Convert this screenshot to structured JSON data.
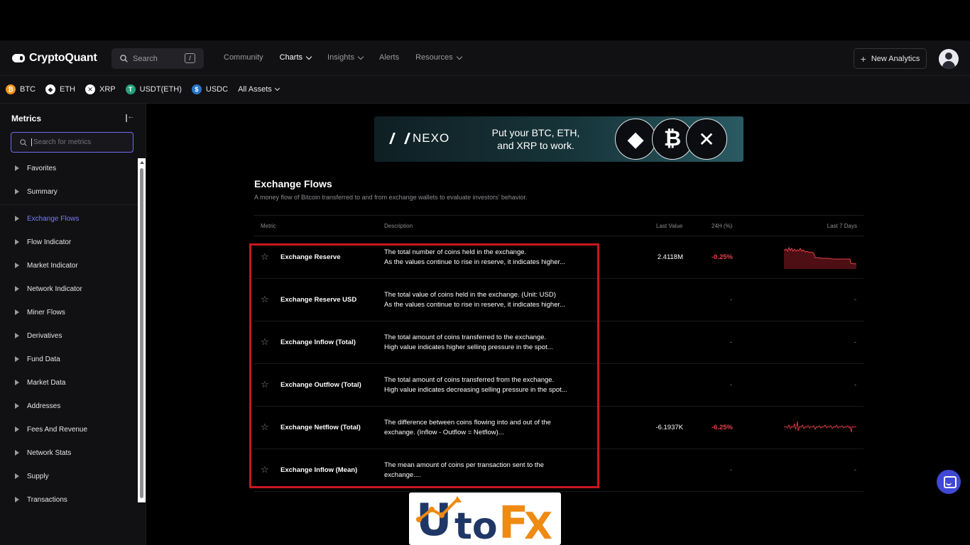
{
  "app": {
    "logo_text": "CryptoQuant",
    "search_placeholder": "Search",
    "search_shortcut": "/",
    "nav": [
      {
        "label": "Community",
        "dropdown": false
      },
      {
        "label": "Charts",
        "dropdown": true,
        "active": true
      },
      {
        "label": "Insights",
        "dropdown": true
      },
      {
        "label": "Alerts",
        "dropdown": false
      },
      {
        "label": "Resources",
        "dropdown": true
      }
    ],
    "new_analytics_label": "New Analytics"
  },
  "assets": [
    {
      "symbol": "BTC",
      "icon": "bitcoin-icon",
      "color": "#f7931a",
      "glyph": "₿"
    },
    {
      "symbol": "ETH",
      "icon": "ethereum-icon",
      "color": "#ffffff",
      "glyph": "◆"
    },
    {
      "symbol": "XRP",
      "icon": "xrp-icon",
      "color": "#ffffff",
      "glyph": "✕"
    },
    {
      "symbol": "USDT(ETH)",
      "icon": "tether-icon",
      "color": "#26a17b",
      "glyph": "T"
    },
    {
      "symbol": "USDC",
      "icon": "usdc-icon",
      "color": "#2775ca",
      "glyph": "$"
    }
  ],
  "all_assets_label": "All Assets",
  "sidebar": {
    "title": "Metrics",
    "search_placeholder": "Search for metrics",
    "items": [
      {
        "label": "Favorites",
        "active": false
      },
      {
        "label": "Summary",
        "active": false
      },
      {
        "label": "Exchange Flows",
        "active": true
      },
      {
        "label": "Flow Indicator",
        "active": false
      },
      {
        "label": "Market Indicator",
        "active": false
      },
      {
        "label": "Network Indicator",
        "active": false
      },
      {
        "label": "Miner Flows",
        "active": false
      },
      {
        "label": "Derivatives",
        "active": false
      },
      {
        "label": "Fund Data",
        "active": false
      },
      {
        "label": "Market Data",
        "active": false
      },
      {
        "label": "Addresses",
        "active": false
      },
      {
        "label": "Fees And Revenue",
        "active": false
      },
      {
        "label": "Network Stats",
        "active": false
      },
      {
        "label": "Supply",
        "active": false
      },
      {
        "label": "Transactions",
        "active": false
      }
    ]
  },
  "banner": {
    "brand": "NEXO",
    "line1": "Put your BTC, ETH,",
    "line2": "and XRP to work.",
    "coins": [
      "◆",
      "₿",
      "✕"
    ]
  },
  "section": {
    "title": "Exchange Flows",
    "description": "A money flow of Bitcoin transferred to and from exchange wallets to evaluate investors' behavior."
  },
  "table": {
    "headers": {
      "metric": "Metric",
      "description": "Description",
      "last_value": "Last Value",
      "change_24h": "24H (%)",
      "last_7_days": "Last 7 Days"
    },
    "rows": [
      {
        "name": "Exchange Reserve",
        "desc1": "The total number of coins held in the exchange.",
        "desc2": "As the values continue to rise in reserve, it indicates higher...",
        "last_value": "2.4118M",
        "change": "-0.25%",
        "spark": "reserve"
      },
      {
        "name": "Exchange Reserve USD",
        "desc1": "The total value of coins held in the exchange. (Unit: USD)",
        "desc2": "As the values continue to rise in reserve, it indicates higher...",
        "last_value": "-",
        "change": "",
        "spark": "none"
      },
      {
        "name": "Exchange Inflow (Total)",
        "desc1": "The total amount of coins transferred to the exchange.",
        "desc2": "High value indicates higher selling pressure in the spot...",
        "last_value": "-",
        "change": "",
        "spark": "none"
      },
      {
        "name": "Exchange Outflow (Total)",
        "desc1": "The total amount of coins transferred from the exchange.",
        "desc2": "High value indicates decreasing selling pressure in the spot...",
        "last_value": "-",
        "change": "",
        "spark": "none"
      },
      {
        "name": "Exchange Netflow (Total)",
        "desc1": "The difference between coins flowing into and out of the",
        "desc2": "exchange. (Inflow - Outflow = Netflow)...",
        "last_value": "-6.1937K",
        "change": "-6.25%",
        "spark": "netflow"
      },
      {
        "name": "Exchange Inflow (Mean)",
        "desc1": "The mean amount of coins per transaction sent to the",
        "desc2": "exchange....",
        "last_value": "-",
        "change": "",
        "spark": "none"
      }
    ],
    "empty_spark": "-"
  },
  "colors": {
    "accent": "#7b7bff",
    "negative": "#e4404a",
    "highlight_box": "#c8161d",
    "chat_button": "#4048d6"
  },
  "watermark": {
    "text": "UtoFX"
  }
}
